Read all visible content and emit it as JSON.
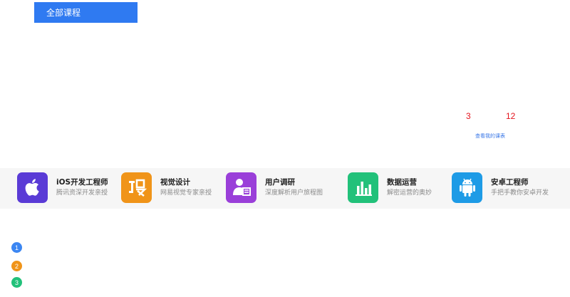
{
  "header": {
    "all_courses_label": "全部课程"
  },
  "stats": {
    "value_1": "3",
    "value_2": "12",
    "my_courses_link": "查看我的课表"
  },
  "courses": [
    {
      "title": "iOS开发工程师",
      "subtitle": "腾讯资深开发亲授",
      "icon": "apple-icon",
      "color": "#5a3bd6"
    },
    {
      "title": "视觉设计",
      "subtitle": "网易视觉专家亲授",
      "icon": "design-icon",
      "color": "#f09419"
    },
    {
      "title": "用户调研",
      "subtitle": "深度解析用户旅程图",
      "icon": "user-research-icon",
      "color": "#9a3fd9"
    },
    {
      "title": "数据运营",
      "subtitle": "解密运营的奥妙",
      "icon": "bar-chart-icon",
      "color": "#22c17a"
    },
    {
      "title": "安卓工程师",
      "subtitle": "手把手教你安卓开发",
      "icon": "android-icon",
      "color": "#1e9be6"
    }
  ],
  "dots": [
    {
      "label": "1",
      "color": "#3b86f2"
    },
    {
      "label": "2",
      "color": "#f09419"
    },
    {
      "label": "3",
      "color": "#22c17a"
    }
  ]
}
